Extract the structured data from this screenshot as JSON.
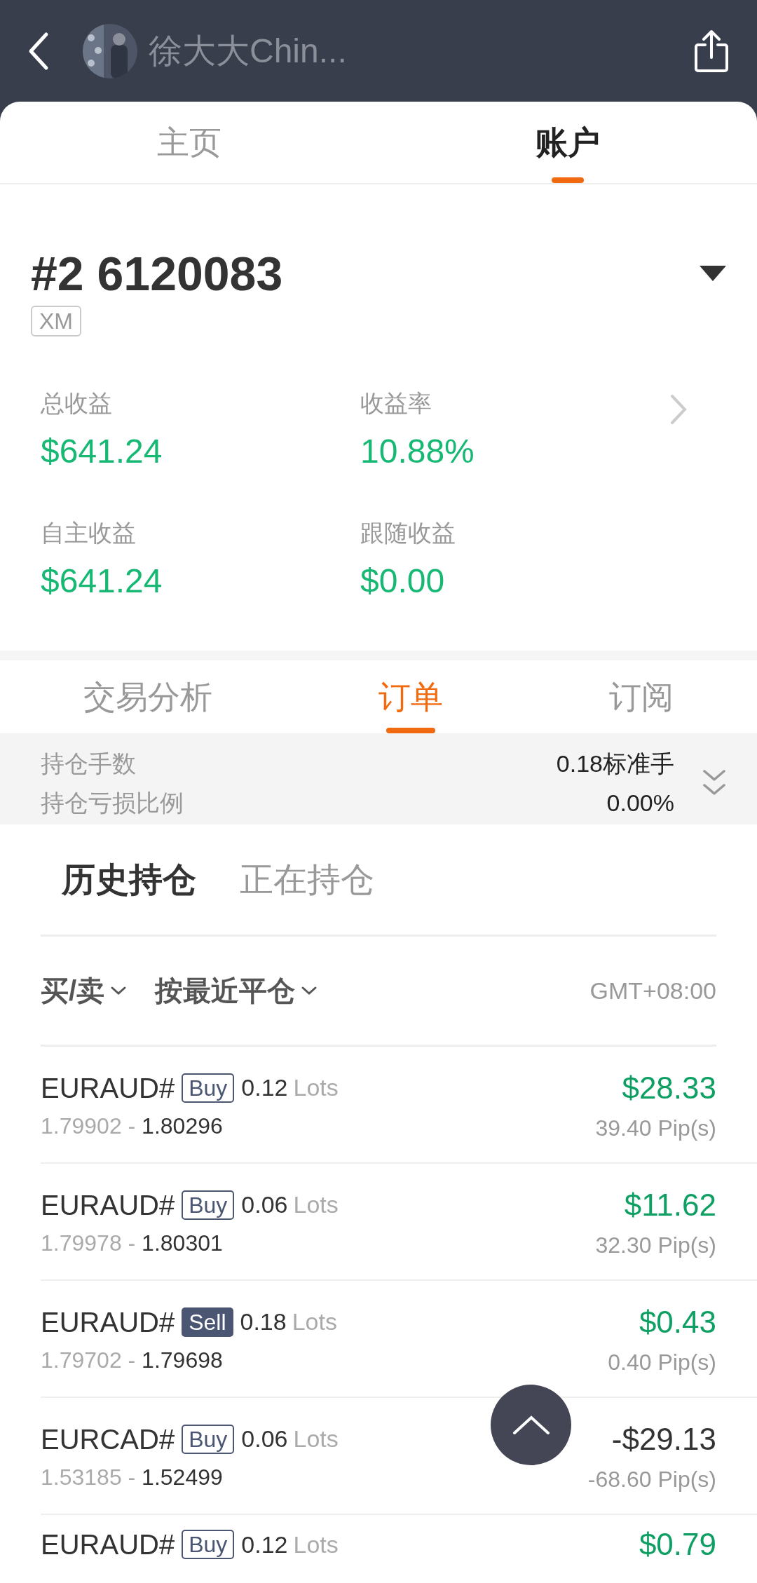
{
  "header": {
    "title": "徐大大Chin..."
  },
  "main_tabs": [
    {
      "label": "主页",
      "selected": false
    },
    {
      "label": "账户",
      "selected": true
    }
  ],
  "account": {
    "number": "#2 6120083",
    "broker": "XM",
    "stats": [
      {
        "label": "总收益",
        "value": "$641.24"
      },
      {
        "label": "收益率",
        "value": "10.88%"
      },
      {
        "label": "自主收益",
        "value": "$641.24"
      },
      {
        "label": "跟随收益",
        "value": "$0.00"
      }
    ]
  },
  "section_tabs": [
    {
      "label": "交易分析",
      "selected": false
    },
    {
      "label": "订单",
      "selected": true
    },
    {
      "label": "订阅",
      "selected": false
    }
  ],
  "summary": [
    {
      "label": "持仓手数",
      "value": "0.18标准手"
    },
    {
      "label": "持仓亏损比例",
      "value": "0.00%"
    }
  ],
  "position_tabs": [
    {
      "label": "历史持仓",
      "selected": true
    },
    {
      "label": "正在持仓",
      "selected": false
    }
  ],
  "filters": [
    {
      "label": "买/卖"
    },
    {
      "label": "按最近平仓"
    }
  ],
  "timezone": "GMT+08:00",
  "orders": [
    {
      "symbol": "EURAUD#",
      "side": "Buy",
      "kind": "buy",
      "lots": "0.12",
      "unit": "Lots",
      "open": "1.79902",
      "separator": "-",
      "close": "1.80296",
      "profit": "$28.33",
      "pips": "39.40 Pip(s)",
      "loss": false
    },
    {
      "symbol": "EURAUD#",
      "side": "Buy",
      "kind": "buy",
      "lots": "0.06",
      "unit": "Lots",
      "open": "1.79978",
      "separator": "-",
      "close": "1.80301",
      "profit": "$11.62",
      "pips": "32.30 Pip(s)",
      "loss": false
    },
    {
      "symbol": "EURAUD#",
      "side": "Sell",
      "kind": "sell",
      "lots": "0.18",
      "unit": "Lots",
      "open": "1.79702",
      "separator": "-",
      "close": "1.79698",
      "profit": "$0.43",
      "pips": "0.40 Pip(s)",
      "loss": false
    },
    {
      "symbol": "EURCAD#",
      "side": "Buy",
      "kind": "buy",
      "lots": "0.06",
      "unit": "Lots",
      "open": "1.53185",
      "separator": "-",
      "close": "1.52499",
      "profit": "-$29.13",
      "pips": "-68.60 Pip(s)",
      "loss": true
    },
    {
      "symbol": "EURAUD#",
      "side": "Buy",
      "kind": "buy",
      "lots": "0.12",
      "unit": "Lots",
      "profit": "$0.79",
      "loss": false
    }
  ]
}
